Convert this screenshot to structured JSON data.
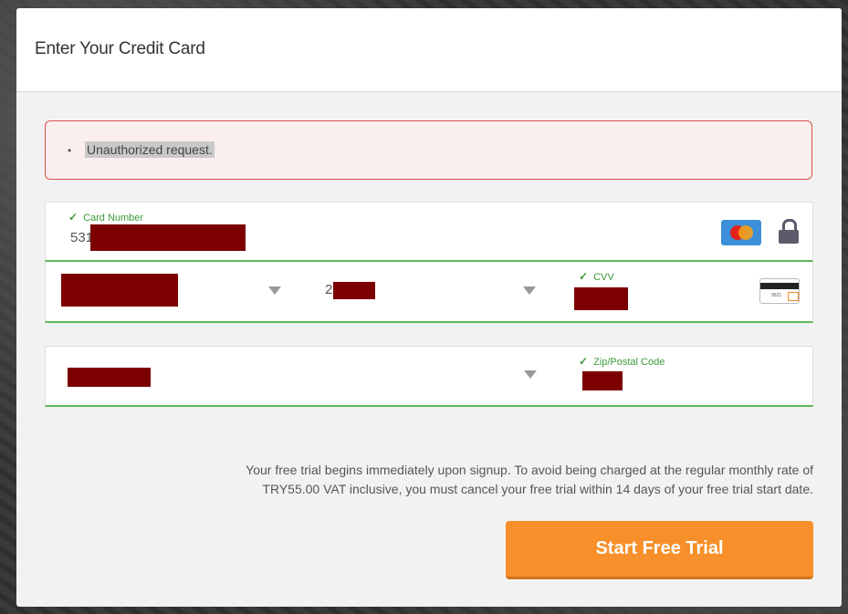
{
  "modal": {
    "title": "Enter Your Credit Card"
  },
  "error": {
    "messages": [
      "Unauthorized request."
    ]
  },
  "card_number": {
    "label": "Card Number",
    "value_visible": "531"
  },
  "year": {
    "value_visible": "2"
  },
  "cvv": {
    "label": "CVV",
    "icon_text": "9521"
  },
  "zip": {
    "label": "Zip/Postal Code"
  },
  "disclaimer": {
    "line1": "Your free trial begins immediately upon signup. To avoid being charged at the regular monthly rate of",
    "line2": "TRY55.00 VAT inclusive, you must cancel your free trial within 14 days of your free trial start date."
  },
  "cta": {
    "label": "Start Free Trial"
  },
  "colors": {
    "accent": "#f7902a",
    "valid": "#5cb85c",
    "error_border": "#d9534f",
    "redaction": "#7d0000"
  },
  "icons": [
    "mastercard-icon",
    "lock-icon",
    "cvv-card-icon",
    "check-icon",
    "chevron-down-icon"
  ]
}
